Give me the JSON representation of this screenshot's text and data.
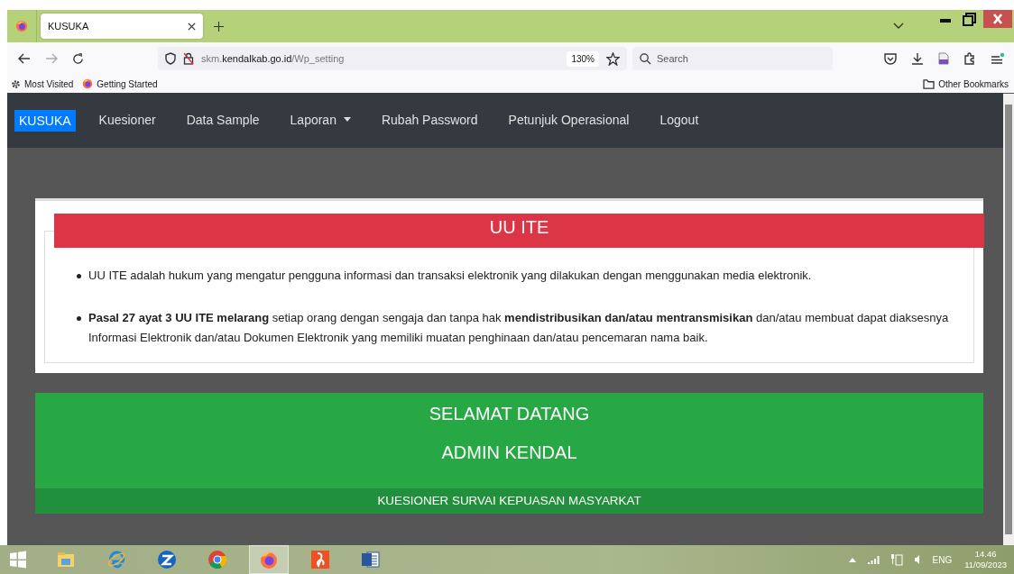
{
  "browser": {
    "tab": {
      "title": "KUSUKA",
      "selected": true
    },
    "url": {
      "prefix": "skm.",
      "domain": "kendalkab.go.id",
      "path": "/Wp_setting"
    },
    "zoom": "130%",
    "search": {
      "placeholder": "Search"
    },
    "bookmarks": [
      {
        "label": "Most Visited",
        "kind": "gear"
      },
      {
        "label": "Getting Started",
        "kind": "firefox"
      }
    ],
    "other_bookmarks": "Other Bookmarks"
  },
  "navbar": {
    "brand": "KUSUKA",
    "items": [
      {
        "label": "Kuesioner",
        "kind": "link"
      },
      {
        "label": "Data Sample",
        "kind": "link"
      },
      {
        "label": "Laporan",
        "kind": "dropdown"
      },
      {
        "label": "Rubah Password",
        "kind": "link"
      },
      {
        "label": "Petunjuk Operasional",
        "kind": "link"
      },
      {
        "label": "Logout",
        "kind": "link"
      }
    ]
  },
  "notice": {
    "title": "UU ITE",
    "items": [
      "UU ITE adalah hukum yang mengatur pengguna informasi dan transaksi elektronik yang dilakukan dengan menggunakan media elektronik.",
      "**Pasal 27 ayat 3 UU ITE melarang** setiap orang dengan sengaja dan tanpa hak **mendistribusikan dan/atau mentransmisikan** dan/atau membuat dapat diaksesnya Informasi Elektronik dan/atau Dokumen Elektronik yang memiliki muatan penghinaan dan/atau pencemaran nama baik."
    ]
  },
  "welcome": {
    "lines": [
      "SELAMAT DATANG",
      "ADMIN KENDAL"
    ],
    "footer": "KUESIONER SURVAI KEPUASAN MASYARKAT"
  },
  "taskbar": {
    "apps": [
      {
        "kind": "explorer",
        "selected": false
      },
      {
        "kind": "ie",
        "selected": false
      },
      {
        "kind": "zoho",
        "selected": false
      },
      {
        "kind": "chrome",
        "selected": false
      },
      {
        "kind": "firefox",
        "selected": true
      },
      {
        "kind": "pdf",
        "selected": false
      },
      {
        "kind": "word",
        "selected": false
      }
    ],
    "language": "ENG",
    "time": "14.46",
    "date": "11/09/2023"
  }
}
